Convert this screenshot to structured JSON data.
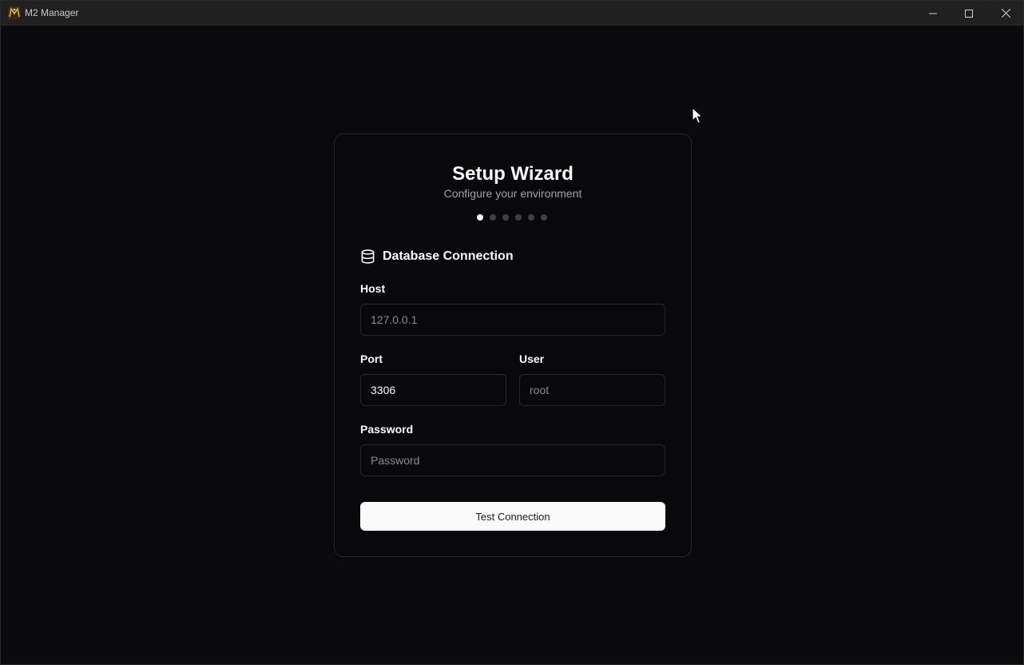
{
  "window": {
    "title": "M2 Manager",
    "icon": "m2-logo-icon"
  },
  "wizard": {
    "title": "Setup Wizard",
    "subtitle": "Configure your environment",
    "steps_total": 6,
    "current_step": 1
  },
  "section": {
    "icon": "database-icon",
    "title": "Database Connection"
  },
  "fields": {
    "host": {
      "label": "Host",
      "value": "",
      "placeholder": "127.0.0.1"
    },
    "port": {
      "label": "Port",
      "value": "3306",
      "placeholder": ""
    },
    "user": {
      "label": "User",
      "value": "",
      "placeholder": "root"
    },
    "password": {
      "label": "Password",
      "value": "",
      "placeholder": "Password"
    }
  },
  "actions": {
    "test_label": "Test Connection"
  },
  "colors": {
    "background": "#0a0a0c",
    "card_border": "#27272a",
    "primary_button": "#fafafa",
    "muted_text": "#a1a1aa"
  }
}
